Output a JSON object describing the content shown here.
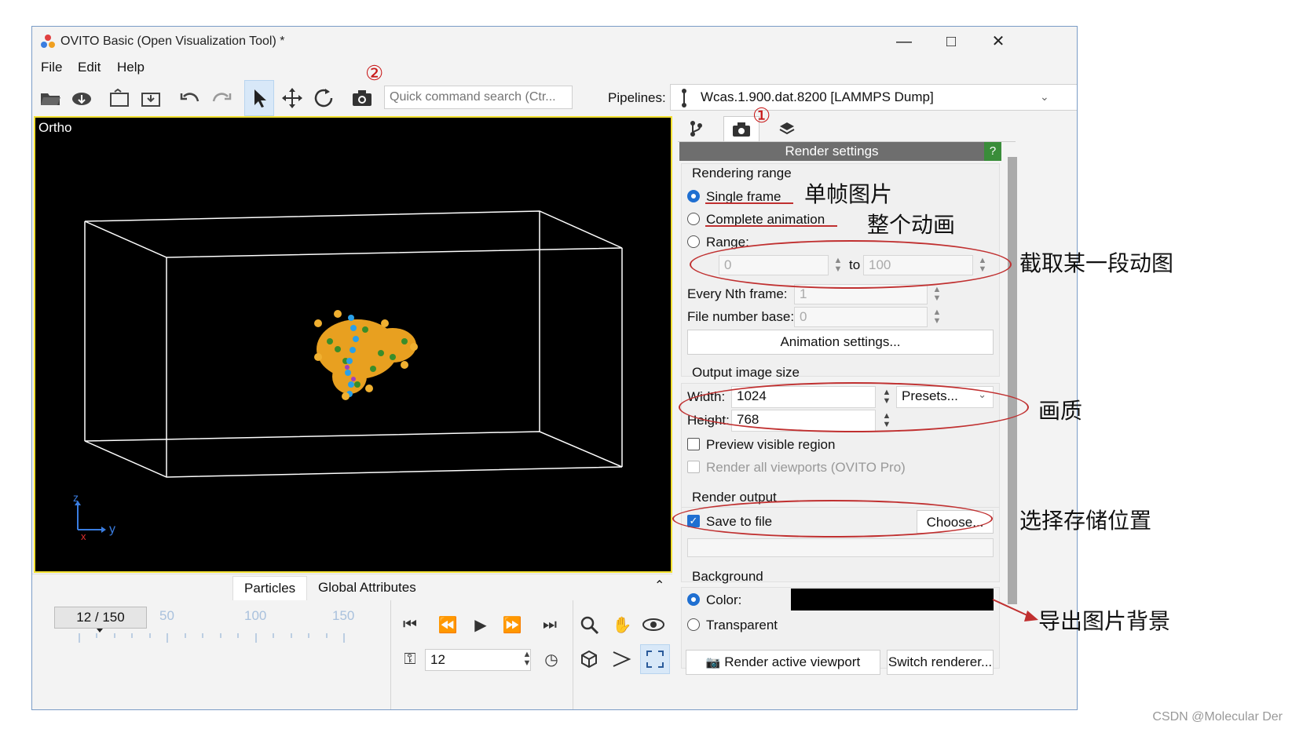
{
  "window": {
    "title": "OVITO Basic (Open Visualization Tool) *",
    "controls": [
      "—",
      "□",
      "✕"
    ]
  },
  "menu": [
    "File",
    "Edit",
    "Help"
  ],
  "toolbar": {
    "search_placeholder": "Quick command search (Ctr...",
    "pipelines_label": "Pipelines:",
    "pipeline_value": "Wcas.1.900.dat.8200 [LAMMPS Dump]"
  },
  "viewport": {
    "label": "Ortho",
    "axis_z": "z",
    "axis_y": "y",
    "axis_x": "x"
  },
  "bottom_tabs": [
    "Particles",
    "Global Attributes"
  ],
  "animation": {
    "frame_display": "12 / 150",
    "ticks": [
      "50",
      "100",
      "150"
    ],
    "current_frame": "12"
  },
  "render_panel": {
    "header": "Render settings",
    "help": "?",
    "rendering_range": {
      "title": "Rendering range",
      "single_frame": "Single frame",
      "complete_animation": "Complete animation",
      "range": "Range:",
      "range_from": "0",
      "range_to_label": "to",
      "range_to": "100",
      "every_nth_label": "Every Nth frame:",
      "every_nth_value": "1",
      "file_number_base_label": "File number base:",
      "file_number_base_value": "0",
      "animation_settings_button": "Animation settings..."
    },
    "output_size": {
      "title": "Output image size",
      "width_label": "Width:",
      "width_value": "1024",
      "height_label": "Height:",
      "height_value": "768",
      "presets": "Presets...",
      "preview_visible_region": "Preview visible region",
      "render_all_viewports": "Render all viewports (OVITO Pro)"
    },
    "render_output": {
      "title": "Render output",
      "save_to_file": "Save to file",
      "choose_button": "Choose..."
    },
    "background": {
      "title": "Background",
      "color_label": "Color:",
      "transparent_label": "Transparent",
      "color_value": "#000000"
    },
    "render_active_viewport": "Render active viewport",
    "switch_renderer": "Switch renderer..."
  },
  "annotations": {
    "marker_1": "①",
    "marker_2": "②",
    "single_frame_note": "单帧图片",
    "complete_animation_note": "整个动画",
    "range_note": "截取某一段动图",
    "size_note": "画质",
    "save_note": "选择存储位置",
    "background_note": "导出图片背景"
  },
  "watermark": "CSDN @Molecular Der"
}
